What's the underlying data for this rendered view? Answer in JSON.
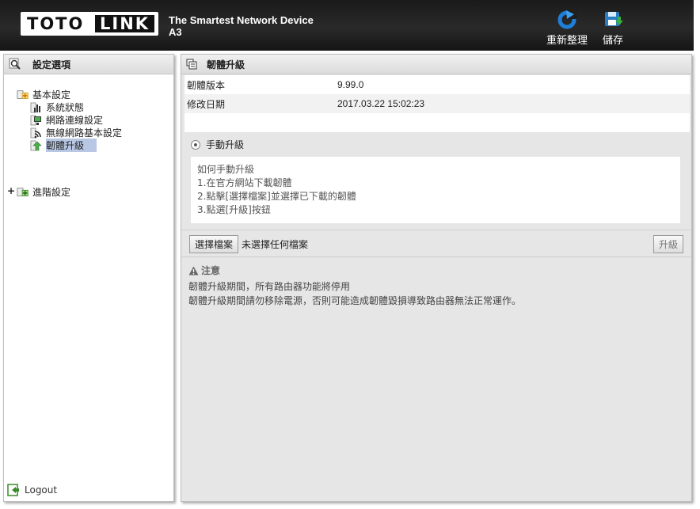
{
  "header": {
    "logo_left": "TOTO",
    "logo_right": "LINK",
    "title_line1": "The Smartest Network Device",
    "title_line2": "A3",
    "refresh_label": "重新整理",
    "save_label": "儲存"
  },
  "sidebar": {
    "title": "設定選項",
    "tree": {
      "basic": "基本設定",
      "items": [
        {
          "label": "系統狀態",
          "icon": "bar-chart-icon"
        },
        {
          "label": "網路連線設定",
          "icon": "network-icon"
        },
        {
          "label": "無線網路基本設定",
          "icon": "wireless-icon"
        },
        {
          "label": "韌體升級",
          "icon": "upgrade-icon"
        }
      ],
      "advanced": "進階設定"
    },
    "logout": "Logout"
  },
  "main": {
    "title": "韌體升級",
    "info": [
      {
        "key": "韌體版本",
        "value": "9.99.0"
      },
      {
        "key": "修改日期",
        "value": "2017.03.22 15:02:23"
      }
    ],
    "manual_label": "手動升級",
    "howto": [
      "如何手動升級",
      "1.在官方網站下載韌體",
      "2.點擊[選擇檔案]並選擇已下載的韌體",
      "3.點選[升級]按鈕"
    ],
    "choose_file": "選擇檔案",
    "no_file": "未選擇任何檔案",
    "upgrade": "升級",
    "note_title": "注意",
    "notes": [
      "韌體升級期間，所有路由器功能將停用",
      "韌體升級期間請勿移除電源，否則可能造成韌體毀損導致路由器無法正常運作。"
    ]
  },
  "colors": {
    "header_bg": "#1f1f1f",
    "selected_bg": "#b8c8e4",
    "panel_bg": "#e6e6e6",
    "refresh_icon": "#1e7fd8",
    "save_icon": "#2a7dc0"
  }
}
